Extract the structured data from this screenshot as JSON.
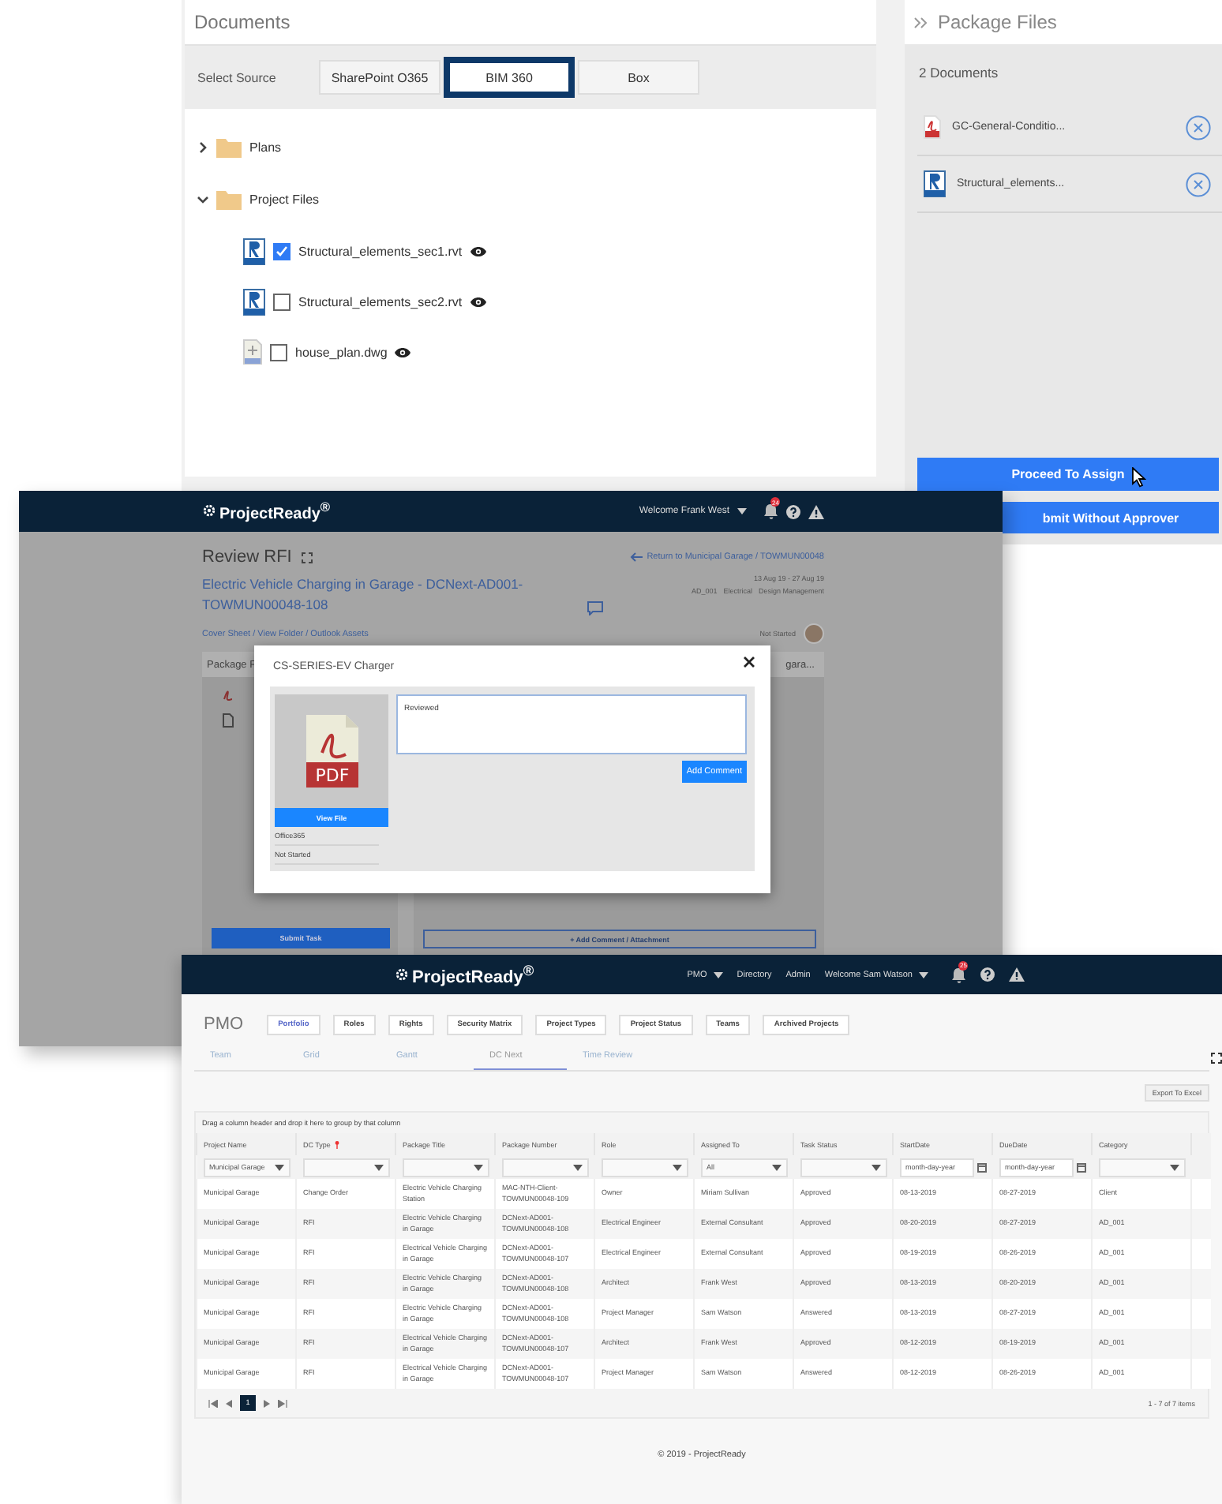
{
  "documents_window": {
    "documents_panel": {
      "title": "Documents",
      "source_label": "Select Source",
      "sources": [
        {
          "label": "SharePoint O365",
          "selected": false
        },
        {
          "label": "BIM 360",
          "selected": true
        },
        {
          "label": "Box",
          "selected": false
        }
      ],
      "tree": [
        {
          "label": "Plans",
          "expanded": false
        },
        {
          "label": "Project Files",
          "expanded": true,
          "children": [
            {
              "label": "Structural_elements_sec1.rvt",
              "kind": "rvt",
              "checked": true
            },
            {
              "label": "Structural_elements_sec2.rvt",
              "kind": "rvt",
              "checked": false
            },
            {
              "label": "house_plan.dwg",
              "kind": "dwg",
              "checked": false
            }
          ]
        }
      ]
    },
    "package_panel": {
      "title": "Package Files",
      "count": "2 Documents",
      "files": [
        {
          "name": "GC-General-Conditio...",
          "kind": "pdf"
        },
        {
          "name": "Structural_elements...",
          "kind": "rvt"
        }
      ],
      "buttons": [
        "Proceed To Assign",
        "bmit Without Approver"
      ]
    }
  },
  "rfi_window": {
    "header": {
      "logo": "ProjectReady$^{®}$",
      "welcome": "Welcome Frank West",
      "notification_count": "24"
    },
    "page": {
      "title": "Review RFI",
      "return_link": "Return to Municipal Garage / TOWMUN00048",
      "package_link": "Electric Vehicle Charging in Garage - DCNext-AD001-TOWMUN00048-108",
      "dates": "13 Aug 19 - 27 Aug 19",
      "meta": [
        "AD_001",
        "Electrical",
        "Design Management"
      ],
      "links": "Cover Sheet / View Folder / Outlook Assets",
      "status": "Not Started",
      "left_panel_title": "Package F",
      "right_panel_title": "gara...",
      "submit_button": "Submit Task",
      "comment_button": "+ Add Comment / Attachment"
    },
    "modal": {
      "title": "CS-SERIES-EV Charger",
      "file_type_label": "PDF",
      "view_button": "View File",
      "details": [
        "Office365",
        "Not Started"
      ],
      "comment": "Reviewed",
      "add_button": "Add Comment"
    }
  },
  "pmo_window": {
    "header": {
      "logo": "ProjectReady$^{®}$",
      "nav": [
        {
          "label": "PMO",
          "dropdown": true
        },
        {
          "label": "Directory",
          "dropdown": false
        },
        {
          "label": "Admin",
          "dropdown": false
        },
        {
          "label": "Welcome Sam Watson",
          "dropdown": true
        }
      ],
      "notification_count": "25"
    },
    "title": "PMO",
    "buttons": [
      {
        "label": "Portfolio",
        "selected": true
      },
      {
        "label": "Roles",
        "selected": false
      },
      {
        "label": "Rights",
        "selected": false
      },
      {
        "label": "Security Matrix",
        "selected": false
      },
      {
        "label": "Project Types",
        "selected": false
      },
      {
        "label": "Project Status",
        "selected": false
      },
      {
        "label": "Teams",
        "selected": false
      },
      {
        "label": "Archived Projects",
        "selected": false
      }
    ],
    "tabs": [
      {
        "label": "Team",
        "selected": false
      },
      {
        "label": "Grid",
        "selected": false
      },
      {
        "label": "Gantt",
        "selected": false
      },
      {
        "label": "DC Next",
        "selected": true
      },
      {
        "label": "Time Review",
        "selected": false
      }
    ],
    "export_button": "Export To Excel",
    "group_hint": "Drag a column header and drop it here to group by that column",
    "table": {
      "columns": [
        {
          "label": "Project Name",
          "required": false
        },
        {
          "label": "DC Type",
          "required": true
        },
        {
          "label": "Package Title",
          "required": false
        },
        {
          "label": "Package Number",
          "required": false
        },
        {
          "label": "Role",
          "required": false
        },
        {
          "label": "Assigned To",
          "required": false
        },
        {
          "label": "Task Status",
          "required": false
        },
        {
          "label": "StartDate",
          "required": false
        },
        {
          "label": "DueDate",
          "required": false
        },
        {
          "label": "Category",
          "required": false
        }
      ],
      "filters": [
        {
          "kind": "select",
          "value": "Municipal Garage"
        },
        {
          "kind": "select"
        },
        {
          "kind": "select"
        },
        {
          "kind": "select"
        },
        {
          "kind": "select"
        },
        {
          "kind": "select",
          "value": "All"
        },
        {
          "kind": "select"
        },
        {
          "kind": "date",
          "placeholder": "month-day-year"
        },
        {
          "kind": "date",
          "placeholder": "month-day-year"
        },
        {
          "kind": "select"
        }
      ],
      "rows": [
        [
          "Municipal Garage",
          "Change Order",
          "Electric Vehicle Charging Station",
          "MAC-NTH-Client-TOWMUN00048-109",
          "Owner",
          "Miriam Sullivan",
          "Approved",
          "08-13-2019",
          "08-27-2019",
          "Client"
        ],
        [
          "Municipal Garage",
          "RFI",
          "Electric Vehicle Charging in Garage",
          "DCNext-AD001-TOWMUN00048-108",
          "Electrical Engineer",
          "External Consultant",
          "Approved",
          "08-20-2019",
          "08-27-2019",
          "AD_001"
        ],
        [
          "Municipal Garage",
          "RFI",
          "Electrical Vehicle Charging in Garage",
          "DCNext-AD001-TOWMUN00048-107",
          "Electrical Engineer",
          "External Consultant",
          "Approved",
          "08-19-2019",
          "08-26-2019",
          "AD_001"
        ],
        [
          "Municipal Garage",
          "RFI",
          "Electric Vehicle Charging in Garage",
          "DCNext-AD001-TOWMUN00048-108",
          "Architect",
          "Frank West",
          "Approved",
          "08-13-2019",
          "08-20-2019",
          "AD_001"
        ],
        [
          "Municipal Garage",
          "RFI",
          "Electric Vehicle Charging in Garage",
          "DCNext-AD001-TOWMUN00048-108",
          "Project Manager",
          "Sam Watson",
          "Answered",
          "08-13-2019",
          "08-27-2019",
          "AD_001"
        ],
        [
          "Municipal Garage",
          "RFI",
          "Electrical Vehicle Charging in Garage",
          "DCNext-AD001-TOWMUN00048-107",
          "Architect",
          "Frank West",
          "Approved",
          "08-12-2019",
          "08-19-2019",
          "AD_001"
        ],
        [
          "Municipal Garage",
          "RFI",
          "Electrical Vehicle Charging in Garage",
          "DCNext-AD001-TOWMUN00048-107",
          "Project Manager",
          "Sam Watson",
          "Answered",
          "08-12-2019",
          "08-26-2019",
          "AD_001"
        ]
      ]
    },
    "pager": {
      "pages": [
        {
          "label": "1",
          "selected": true
        }
      ],
      "summary": "1 - 7 of 7 items"
    },
    "footer": "© 2019 - ProjectReady"
  }
}
